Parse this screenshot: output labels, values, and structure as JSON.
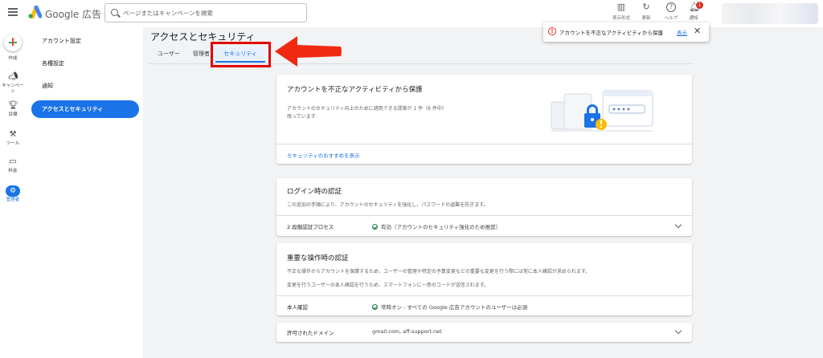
{
  "header": {
    "brand": "Google 広告",
    "search_placeholder": "ページまたはキャンペーンを検索",
    "tools": [
      {
        "icon": "display-format-icon",
        "label": "表示形式"
      },
      {
        "icon": "refresh-icon",
        "label": "更新"
      },
      {
        "icon": "help-icon",
        "label": "ヘルプ"
      },
      {
        "icon": "bell-icon",
        "label": "通知",
        "badge": "1"
      }
    ]
  },
  "rail": {
    "create": "作成",
    "campaign": "キャンペーン",
    "goals": "目標",
    "tools": "ツール",
    "billing": "料金",
    "admin": "管理者"
  },
  "nav": {
    "items": [
      "アカウント設定",
      "各種設定",
      "通知",
      "アクセスとセキュリティ"
    ],
    "active_index": 3
  },
  "page": {
    "title": "アクセスとセキュリティ",
    "tabs": [
      "ユーザー",
      "管理者",
      "セキュリティ"
    ]
  },
  "toast": {
    "text": "アカウントを不正なアクティビティから保護",
    "link": "表示"
  },
  "security_card": {
    "title": "アカウントを不正なアクティビティから保護",
    "body": "アカウントのセキュリティ向上のために適用できる提案が 1 件（6 件中）残っています",
    "link": "セキュリティのおすすめを表示"
  },
  "login_card": {
    "title": "ログイン時の認証",
    "body": "この追加の手順により、アカウントのセキュリティを強化し、パスワードの盗難を防ぎます。",
    "row_label": "2 段階認証プロセス",
    "row_value": "有効（アカウントのセキュリティ強化のため推奨）"
  },
  "critical_card": {
    "title": "重要な操作時の認証",
    "body1": "不正な操作からアカウントを保護するため、ユーザーの管理や特定の予算変更などの重要な変更を行う際には常に本人確認が求められます。",
    "body2": "変更を行うユーザーの本人確認を行うため、スマートフォンに一意のコードが送信されます。",
    "row_label": "本人確認",
    "row_value": "常時オン - すべての Google 広告アカウントのユーザーは必須"
  },
  "domain_card": {
    "label": "許可されたドメイン",
    "value": "gmail.com, aff-support.net"
  },
  "colors": {
    "accent": "#1a73e8",
    "highlight": "#e00000",
    "success": "#188038",
    "error": "#d93025"
  }
}
